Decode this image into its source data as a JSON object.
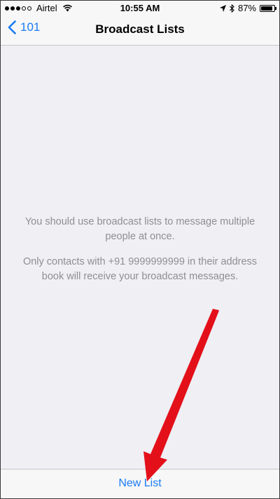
{
  "status_bar": {
    "carrier": "Airtel",
    "time": "10:55 AM",
    "battery_percent": "87%",
    "battery_level": 0.87,
    "signal_bars_filled": 3,
    "signal_bars_total": 5
  },
  "nav": {
    "back_label": "101",
    "title": "Broadcast Lists"
  },
  "content": {
    "line1": "You should use broadcast lists to message multiple people at once.",
    "line2": "Only contacts with +91 9999999999 in their address book will receive your broadcast messages."
  },
  "bottom": {
    "new_list_label": "New List"
  },
  "colors": {
    "accent": "#1a7cf5",
    "annotation_arrow": "#e3101a"
  }
}
